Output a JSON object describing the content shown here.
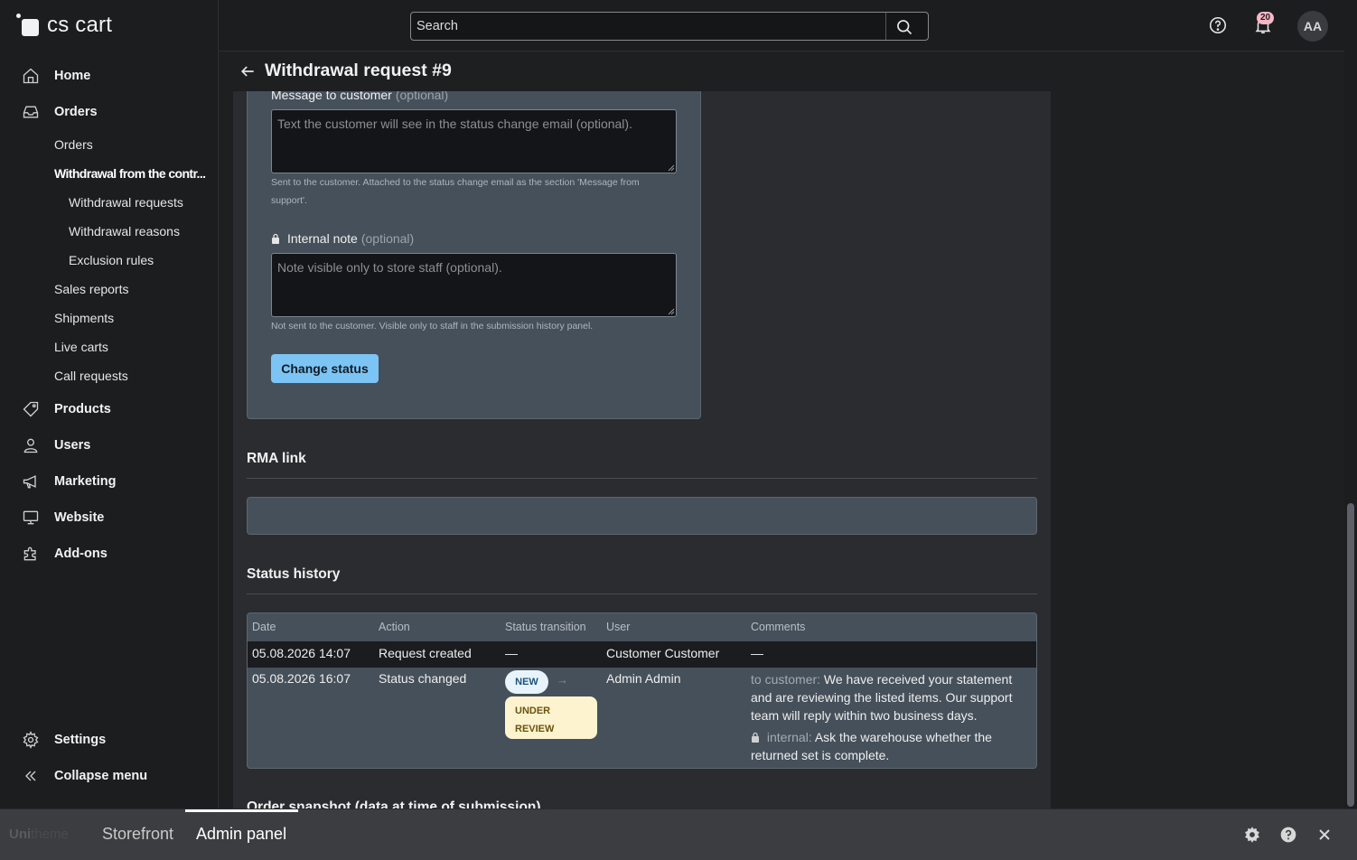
{
  "brand": {
    "name": "cs cart"
  },
  "header": {
    "search_placeholder": "Search",
    "notifications_count": "20",
    "avatar_initials": "AA"
  },
  "sidebar": {
    "items": [
      {
        "label": "Home",
        "icon": "home-icon"
      },
      {
        "label": "Orders",
        "icon": "inbox-icon"
      },
      {
        "label": "Products",
        "icon": "tag-icon"
      },
      {
        "label": "Users",
        "icon": "user-icon"
      },
      {
        "label": "Marketing",
        "icon": "megaphone-icon"
      },
      {
        "label": "Website",
        "icon": "monitor-icon"
      },
      {
        "label": "Add-ons",
        "icon": "puzzle-icon"
      }
    ],
    "orders_sub": [
      {
        "label": "Orders"
      },
      {
        "label": "Withdrawal from the contr...",
        "active": true
      },
      {
        "label": "Withdrawal requests",
        "level": 3
      },
      {
        "label": "Withdrawal reasons",
        "level": 3
      },
      {
        "label": "Exclusion rules",
        "level": 3
      },
      {
        "label": "Sales reports"
      },
      {
        "label": "Shipments"
      },
      {
        "label": "Live carts"
      },
      {
        "label": "Call requests"
      }
    ],
    "settings_label": "Settings",
    "collapse_label": "Collapse menu"
  },
  "page": {
    "title": "Withdrawal request #9"
  },
  "form": {
    "message_label": "Message to customer",
    "message_optional": "(optional)",
    "message_placeholder": "Text the customer will see in the status change email (optional).",
    "message_help": "Sent to the customer. Attached to the status change email as the section 'Message from support'.",
    "note_label": "Internal note",
    "note_optional": "(optional)",
    "note_placeholder": "Note visible only to store staff (optional).",
    "note_help": "Not sent to the customer. Visible only to staff in the submission history panel.",
    "submit_label": "Change status"
  },
  "rma": {
    "title": "RMA link"
  },
  "history": {
    "title": "Status history",
    "columns": [
      "Date",
      "Action",
      "Status transition",
      "User",
      "Comments"
    ],
    "rows": [
      {
        "date": "05.08.2026 14:07",
        "action": "Request created",
        "transition": "—",
        "user": "Customer Customer",
        "comments": "—"
      },
      {
        "date": "05.08.2026 16:07",
        "action": "Status changed",
        "from": "NEW",
        "arrow": "→",
        "to": "UNDER REVIEW",
        "user": "Admin Admin",
        "customer_label": "to customer:",
        "customer_comment": "We have received your statement and are reviewing the listed items. Our support team will reply within two business days.",
        "internal_label": "internal:",
        "internal_comment": "Ask the warehouse whether the returned set is complete."
      }
    ]
  },
  "snapshot": {
    "title": "Order snapshot (data at time of submission)"
  },
  "bottombar": {
    "brand_bold": "Uni",
    "brand_light": "theme",
    "tabs": [
      "Storefront",
      "Admin panel"
    ],
    "active_tab": "Admin panel"
  },
  "colors": {
    "accent": "#7cc4f4",
    "card": "#46505a",
    "new_badge": "#e8f4fb",
    "under_review_badge": "#fdf4cf",
    "notification_badge": "#f7b8c6"
  }
}
